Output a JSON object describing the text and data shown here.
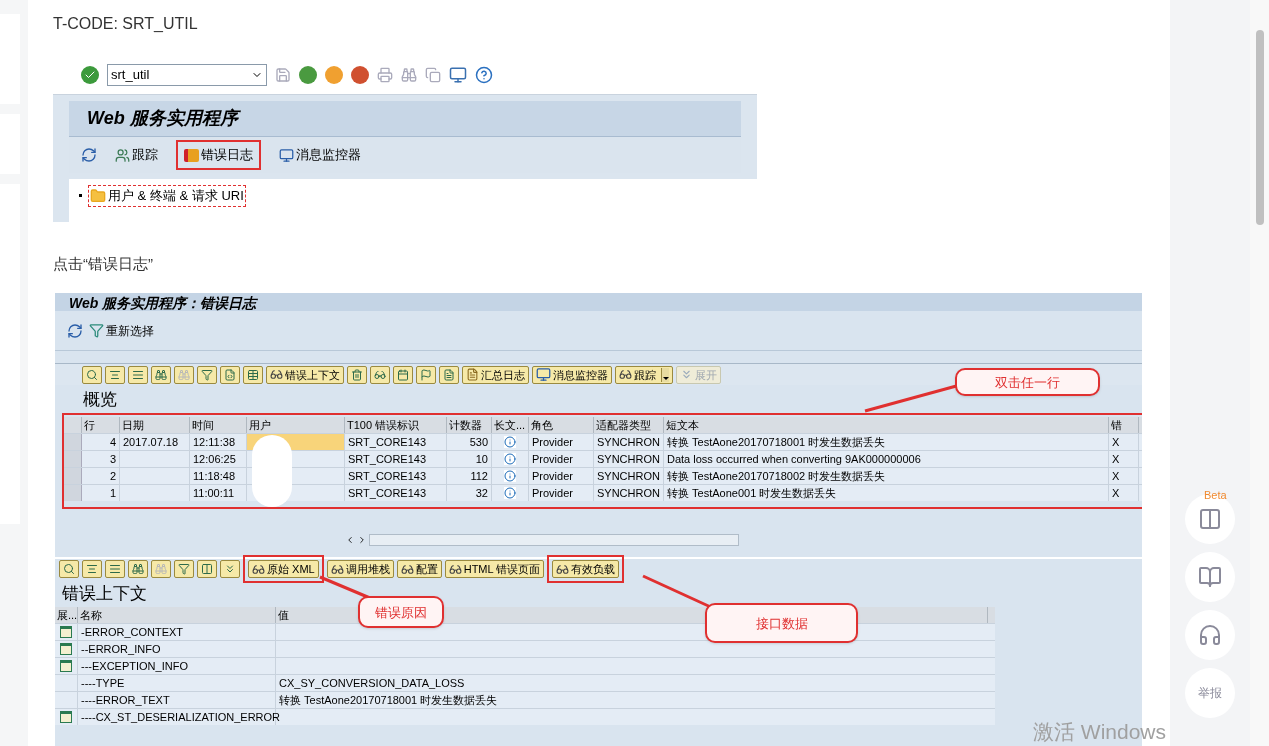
{
  "heading": "T-CODE: SRT_UTIL",
  "screenshot_1": {
    "command_field": {
      "value": "srt_util"
    },
    "title": "Web 服务实用程序",
    "toolbar": [
      {
        "kind": "refresh"
      },
      {
        "kind": "people",
        "label": "跟踪",
        "highlighted": false
      },
      {
        "kind": "error-log",
        "label": "错误日志",
        "highlighted": true
      },
      {
        "kind": "monitor",
        "label": "消息监控器",
        "highlighted": false
      }
    ],
    "tree": [
      {
        "label": "用户 & 终端 & 请求 URI",
        "focused": true
      }
    ]
  },
  "instruction": "点击“错误日志”",
  "screenshot_2": {
    "title": "Web 服务实用程序：错误日志",
    "toolbar": [
      {
        "kind": "refresh"
      },
      {
        "kind": "filter",
        "label": "重新选择"
      }
    ],
    "grid_toolbar": [
      {
        "label": "错误上下文",
        "dropdown": false,
        "disabled": false
      },
      {
        "label": "汇总日志",
        "dropdown": false,
        "disabled": false
      },
      {
        "label": "消息监控器",
        "dropdown": false,
        "disabled": false
      },
      {
        "label": "跟踪",
        "dropdown": true,
        "disabled": false
      },
      {
        "label": "展开",
        "dropdown": false,
        "disabled": true
      }
    ],
    "overview": {
      "title": "概览",
      "columns": [
        "行",
        "日期",
        "时间",
        "用户",
        "T100 错误标识",
        "计数器",
        "长文...",
        "角色",
        "适配器类型",
        "短文本",
        "错"
      ],
      "rows": [
        {
          "cells": [
            "4",
            "2017.07.18",
            "12:11:38",
            "",
            "SRT_CORE143",
            "530",
            "",
            "Provider",
            "SYNCHRON",
            "转换 TestAone20170718001 时发生数据丢失",
            "X"
          ],
          "selected": true
        },
        {
          "cells": [
            "3",
            "",
            "12:06:25",
            "",
            "SRT_CORE143",
            "10",
            "",
            "Provider",
            "SYNCHRON",
            "Data loss occurred when converting 9AK000000006",
            "X"
          ],
          "selected": false
        },
        {
          "cells": [
            "2",
            "",
            "11:18:48",
            "",
            "SRT_CORE143",
            "112",
            "",
            "Provider",
            "SYNCHRON",
            "转换 TestAone20170718002 时发生数据丢失",
            "X"
          ],
          "selected": false
        },
        {
          "cells": [
            "1",
            "",
            "11:00:11",
            "",
            "SRT_CORE143",
            "32",
            "",
            "Provider",
            "SYNCHRON",
            "转换 TestAone001 时发生数据丢失",
            "X"
          ],
          "selected": false
        }
      ]
    },
    "detail_toolbar": [
      {
        "label": "原始 XML",
        "highlighted": true
      },
      {
        "label": "调用堆栈",
        "highlighted": false
      },
      {
        "label": "配置",
        "highlighted": false
      },
      {
        "label": "HTML 错误页面",
        "highlighted": false
      },
      {
        "label": "有效负载",
        "highlighted": true
      }
    ],
    "context": {
      "title": "错误上下文",
      "columns": [
        "展...",
        "名称",
        "值"
      ],
      "rows": [
        {
          "name": "-ERROR_CONTEXT",
          "value": "",
          "expandable": true
        },
        {
          "name": "--ERROR_INFO",
          "value": "",
          "expandable": true
        },
        {
          "name": "---EXCEPTION_INFO",
          "value": "",
          "expandable": true
        },
        {
          "name": "----TYPE",
          "value": "CX_SY_CONVERSION_DATA_LOSS",
          "expandable": false
        },
        {
          "name": "----ERROR_TEXT",
          "value": "转换 TestAone20170718001 时发生数据丢失",
          "expandable": false
        },
        {
          "name": "----CX_ST_DESERIALIZATION_ERROR",
          "value": "",
          "expandable": true
        }
      ]
    },
    "callouts": [
      "双击任一行",
      "错误原因",
      "接口数据"
    ]
  },
  "sidebar": {
    "badge": "Beta",
    "report": "举报"
  },
  "activation_notice": "激活 Windows"
}
